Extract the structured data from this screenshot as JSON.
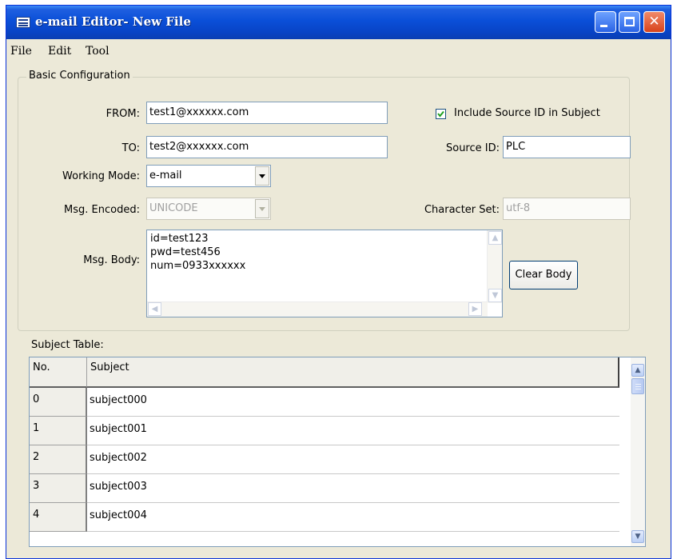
{
  "window": {
    "title": "e-mail Editor- New File"
  },
  "menu": [
    {
      "label": "File"
    },
    {
      "label": "Edit"
    },
    {
      "label": "Tool"
    }
  ],
  "basic_config": {
    "legend": "Basic Configuration",
    "from_label": "FROM:",
    "from_value": "test1@xxxxxx.com",
    "to_label": "TO:",
    "to_value": "test2@xxxxxx.com",
    "include_source_label": "Include Source ID in Subject",
    "include_source_checked": true,
    "source_id_label": "Source ID:",
    "source_id_value": "PLC",
    "working_mode_label": "Working Mode:",
    "working_mode_value": "e-mail",
    "msg_encoded_label": "Msg. Encoded:",
    "msg_encoded_value": "UNICODE",
    "charset_label": "Character Set:",
    "charset_value": "utf-8",
    "msg_body_label": "Msg. Body:",
    "msg_body_lines": [
      "id=test123",
      "pwd=test456",
      "num=0933xxxxxx"
    ],
    "clear_body_label": "Clear Body"
  },
  "subject_table": {
    "label": "Subject Table:",
    "columns": [
      "No.",
      "Subject"
    ],
    "rows": [
      {
        "no": "0",
        "subject": "subject000"
      },
      {
        "no": "1",
        "subject": "subject001"
      },
      {
        "no": "2",
        "subject": "subject002"
      },
      {
        "no": "3",
        "subject": "subject003"
      },
      {
        "no": "4",
        "subject": "subject004"
      }
    ]
  }
}
